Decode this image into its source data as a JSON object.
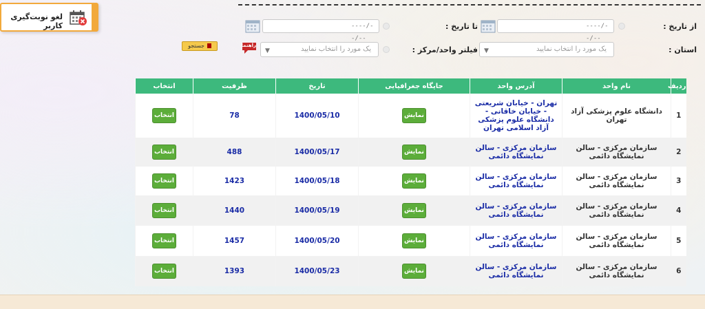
{
  "header": {
    "cancel_label": "لغو نوبت‌گیری کاربر"
  },
  "filters": {
    "from_date_label": "از تاریخ :",
    "to_date_label": "تا تاریخ :",
    "date_placeholder": "----/--/--",
    "province_label": "استان :",
    "unit_filter_label": "فیلتر واحد/مرکز :",
    "select_placeholder": "یک مورد را انتخاب نمایید",
    "search_label": "جستجو",
    "help_label": "راهنما"
  },
  "table": {
    "columns": [
      "ردیف",
      "نام واحد",
      "آدرس واحد",
      "جایگاه جغرافیایی",
      "تاریخ",
      "ظرفیت",
      "انتخاب"
    ],
    "show_label": "نمایش",
    "select_label": "انتخاب",
    "rows": [
      {
        "idx": "1",
        "name": "دانشگاه علوم پزشکی آزاد تهران",
        "address": "تهران - خیابان شریعتی - خیابان خاقانی - دانشگاه علوم پزشکی آزاد اسلامی تهران",
        "date": "1400/05/10",
        "capacity": "78"
      },
      {
        "idx": "2",
        "name": "سازمان مرکزی - سالن نمایشگاه دائمی",
        "address": "سازمان مرکزی - سالن نمایشگاه دائمی",
        "date": "1400/05/17",
        "capacity": "488"
      },
      {
        "idx": "3",
        "name": "سازمان مرکزی - سالن نمایشگاه دائمی",
        "address": "سازمان مرکزی - سالن نمایشگاه دائمی",
        "date": "1400/05/18",
        "capacity": "1423"
      },
      {
        "idx": "4",
        "name": "سازمان مرکزی - سالن نمایشگاه دائمی",
        "address": "سازمان مرکزی - سالن نمایشگاه دائمی",
        "date": "1400/05/19",
        "capacity": "1440"
      },
      {
        "idx": "5",
        "name": "سازمان مرکزی - سالن نمایشگاه دائمی",
        "address": "سازمان مرکزی - سالن نمایشگاه دائمی",
        "date": "1400/05/20",
        "capacity": "1457"
      },
      {
        "idx": "6",
        "name": "سازمان مرکزی - سالن نمایشگاه دائمی",
        "address": "سازمان مرکزی - سالن نمایشگاه دائمی",
        "date": "1400/05/23",
        "capacity": "1393"
      }
    ]
  },
  "colors": {
    "header_green": "#3db97d",
    "button_green": "#5cad3a",
    "accent_orange": "#f2a93b",
    "link_blue": "#1a2ca6"
  }
}
